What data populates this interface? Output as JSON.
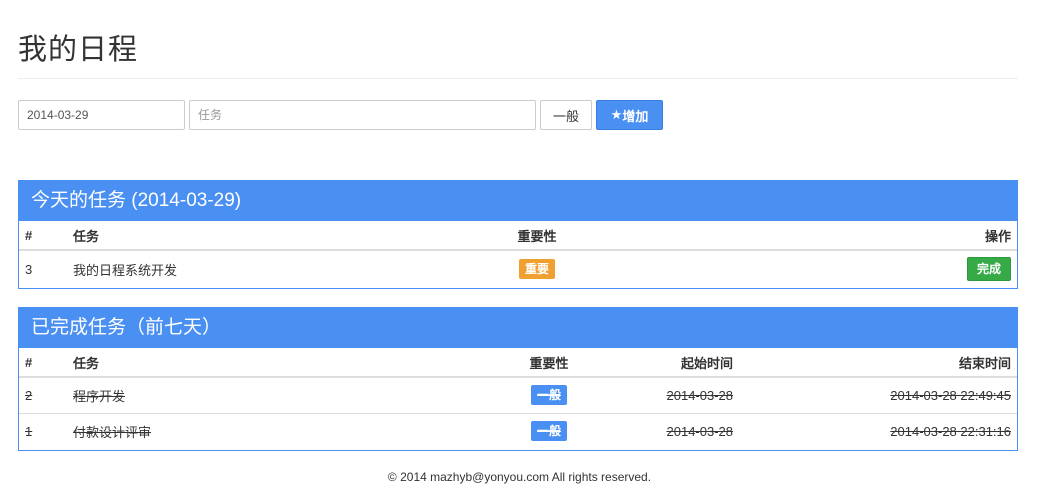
{
  "page": {
    "title": "我的日程"
  },
  "form": {
    "date_value": "2014-03-29",
    "task_placeholder": "任务",
    "priority_label": "一般",
    "add_icon": "star-icon",
    "add_glyph": "★",
    "add_label": "增加"
  },
  "today": {
    "heading": "今天的任务 (2014-03-29)",
    "headers": {
      "num": "#",
      "task": "任务",
      "importance": "重要性",
      "action": "操作"
    },
    "rows": [
      {
        "num": "3",
        "task": "我的日程系统开发",
        "importance": "重要",
        "action": "完成"
      }
    ]
  },
  "completed": {
    "heading": "已完成任务（前七天）",
    "headers": {
      "num": "#",
      "task": "任务",
      "importance": "重要性",
      "start": "起始时间",
      "end": "结束时间"
    },
    "rows": [
      {
        "num": "2",
        "task": "程序开发",
        "importance": "一般",
        "start": "2014-03-28",
        "end": "2014-03-28 22:49:45"
      },
      {
        "num": "1",
        "task": "付款设计评审",
        "importance": "一般",
        "start": "2014-03-28",
        "end": "2014-03-28 22:31:16"
      }
    ]
  },
  "colors": {
    "accent": "#4a8ff2",
    "important": "#f0a030",
    "success": "#35aa47"
  },
  "footer": {
    "text": "© 2014 mazhyb@yonyou.com All rights reserved."
  }
}
